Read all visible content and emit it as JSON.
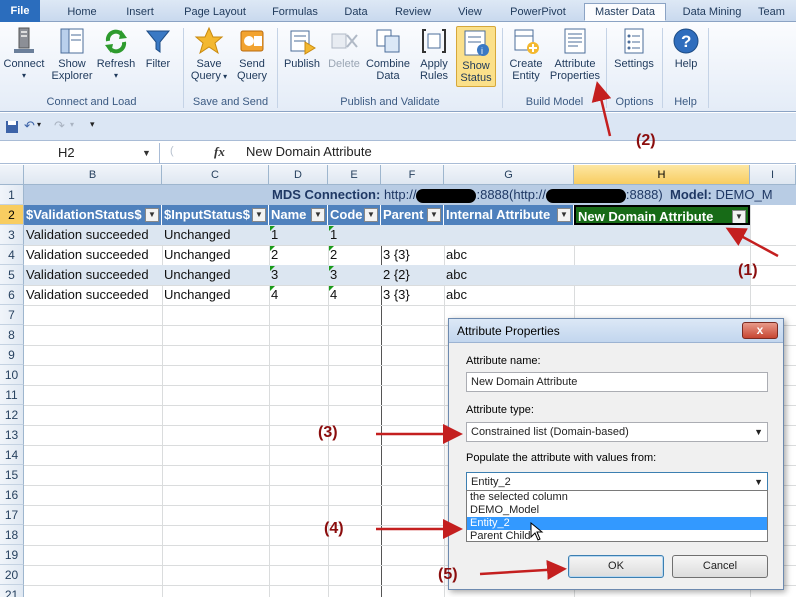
{
  "ribbon": {
    "tabs": [
      "File",
      "Home",
      "Insert",
      "Page Layout",
      "Formulas",
      "Data",
      "Review",
      "View",
      "PowerPivot",
      "Master Data",
      "Data Mining",
      "Team"
    ],
    "active_tab": "Master Data",
    "groups": {
      "connect_load": "Connect and Load",
      "save_send": "Save and Send",
      "publish_validate": "Publish and Validate",
      "build_model": "Build Model",
      "options": "Options",
      "help": "Help"
    },
    "buttons": {
      "connect": "Connect",
      "show_explorer_1": "Show",
      "show_explorer_2": "Explorer",
      "refresh": "Refresh",
      "filter": "Filter",
      "save_query_1": "Save",
      "save_query_2": "Query",
      "send_query_1": "Send",
      "send_query_2": "Query",
      "publish": "Publish",
      "delete": "Delete",
      "combine_data_1": "Combine",
      "combine_data_2": "Data",
      "apply_rules_1": "Apply",
      "apply_rules_2": "Rules",
      "show_status_1": "Show",
      "show_status_2": "Status",
      "create_entity_1": "Create",
      "create_entity_2": "Entity",
      "attribute_properties_1": "Attribute",
      "attribute_properties_2": "Properties",
      "settings": "Settings",
      "help": "Help"
    }
  },
  "formula_bar": {
    "name_box": "H2",
    "fx": "fx",
    "value": "New Domain Attribute"
  },
  "grid": {
    "columns": [
      "B",
      "C",
      "D",
      "E",
      "F",
      "G",
      "H",
      "I"
    ],
    "rows": [
      "1",
      "2",
      "3",
      "4",
      "5",
      "6",
      "7",
      "8",
      "9",
      "10",
      "11",
      "12",
      "13",
      "14",
      "15",
      "16",
      "17",
      "18",
      "19",
      "20",
      "21"
    ],
    "row1": {
      "mds_label": "MDS Connection:",
      "url_a": "http://",
      "url_b": ":8888(http://",
      "url_c": ":8888)",
      "model_label": "Model:",
      "model_value": "DEMO_M"
    },
    "headers": [
      "$ValidationStatus$",
      "$InputStatus$",
      "Name",
      "Code",
      "Parent",
      "Internal Attribute",
      "New Domain Attribute"
    ],
    "data": [
      [
        "Validation succeeded",
        "Unchanged",
        "1",
        "1",
        "",
        "",
        ""
      ],
      [
        "Validation succeeded",
        "Unchanged",
        "2",
        "2",
        "3 {3}",
        "abc",
        ""
      ],
      [
        "Validation succeeded",
        "Unchanged",
        "3",
        "3",
        "2 {2}",
        "abc",
        ""
      ],
      [
        "Validation succeeded",
        "Unchanged",
        "4",
        "4",
        "3 {3}",
        "abc",
        ""
      ]
    ]
  },
  "dialog": {
    "title": "Attribute Properties",
    "close": "x",
    "name_label": "Attribute name:",
    "name_value": "New Domain Attribute",
    "type_label": "Attribute type:",
    "type_value": "Constrained list (Domain-based)",
    "populate_label": "Populate the attribute with values from:",
    "populate_value": "Entity_2",
    "options": [
      "the selected column",
      "DEMO_Model",
      "Entity_2",
      "Parent Child"
    ],
    "ok": "OK",
    "cancel": "Cancel"
  },
  "callouts": [
    "(1)",
    "(2)",
    "(3)",
    "(4)",
    "(5)"
  ],
  "colors": {
    "header_blue": "#4f81bd",
    "header_green": "#176b17",
    "callout": "#8b0d0d",
    "band": "#dce6f1"
  }
}
